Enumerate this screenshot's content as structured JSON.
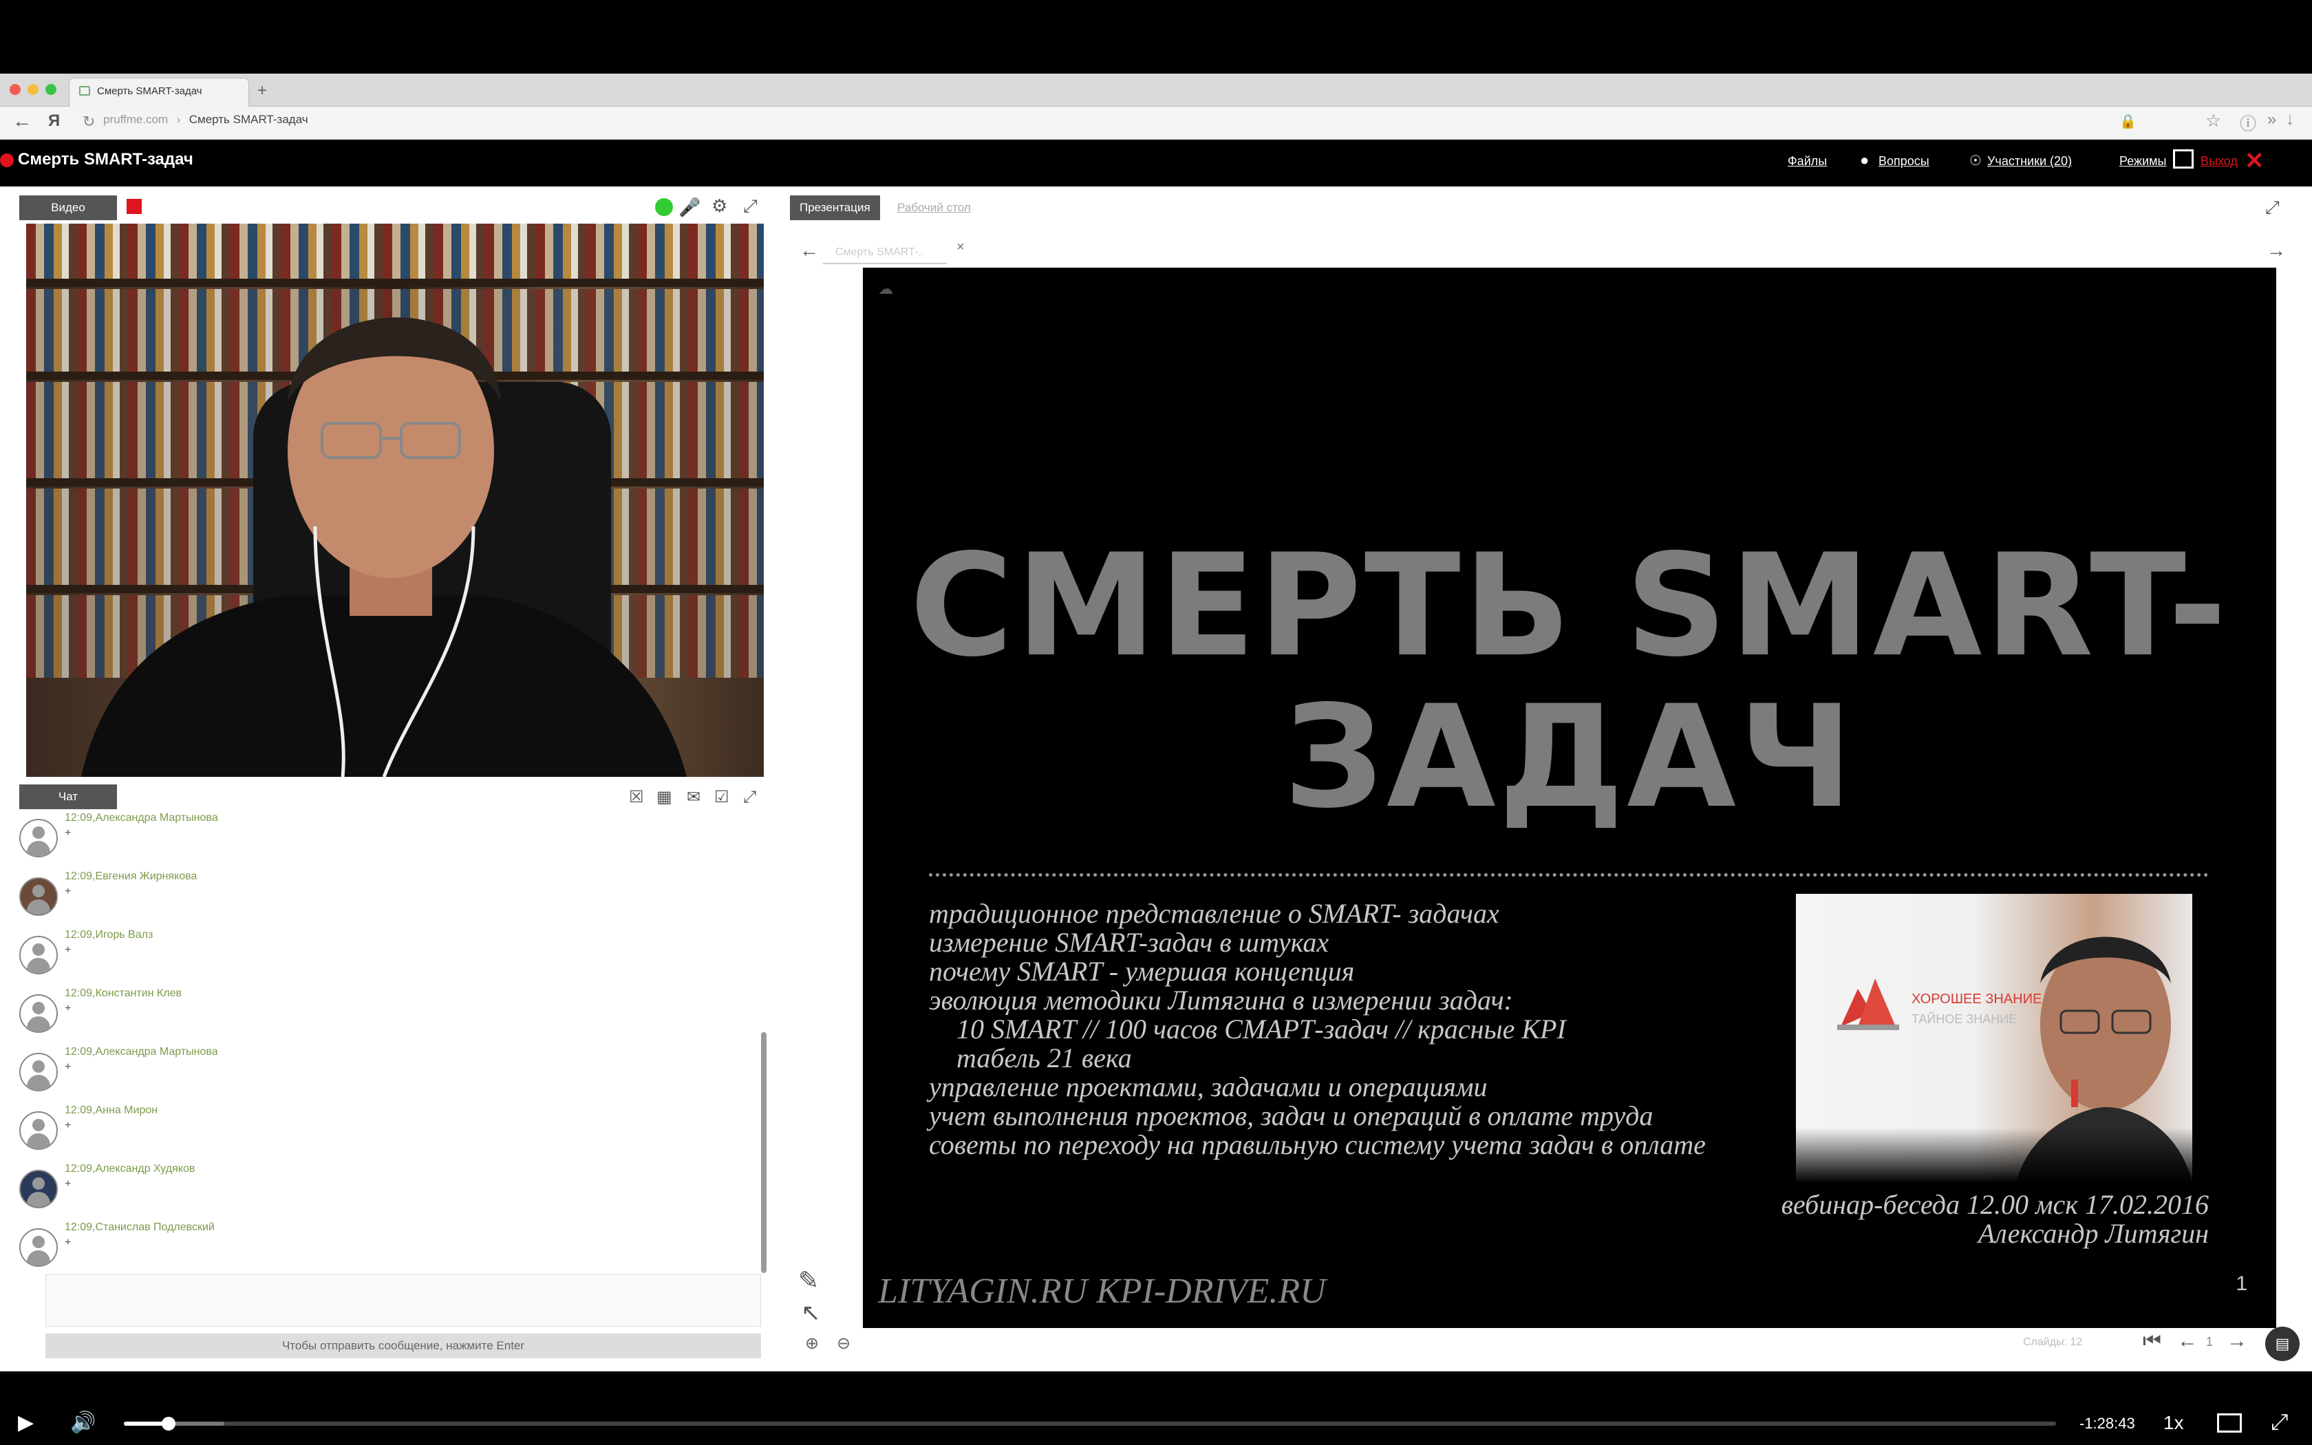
{
  "browser": {
    "tab_title": "Смерть SMART-задач",
    "url_domain": "pruffme.com",
    "url_page": "Смерть SMART-задач"
  },
  "app": {
    "title": "Смерть SMART-задач",
    "nav": {
      "files": "Файлы",
      "questions": "Вопросы",
      "participants": "Участники (20)",
      "modes": "Режимы",
      "exit": "Выход"
    }
  },
  "video_panel": {
    "tab": "Видео"
  },
  "chat": {
    "tab": "Чат",
    "messages": [
      {
        "time_name": "12:09,Александра Мартынова",
        "text": "+"
      },
      {
        "time_name": "12:09,Евгения Жирнякова",
        "text": "+"
      },
      {
        "time_name": "12:09,Игорь Валз",
        "text": "+"
      },
      {
        "time_name": "12:09,Константин Клев",
        "text": "+"
      },
      {
        "time_name": "12:09,Александра Мартынова",
        "text": "+"
      },
      {
        "time_name": "12:09,Анна Мирон",
        "text": "+"
      },
      {
        "time_name": "12:09,Александр Худяков",
        "text": "+"
      },
      {
        "time_name": "12:09,Станислав Подлевский",
        "text": "+"
      }
    ],
    "send_hint": "Чтобы отправить сообщение, нажмите Enter"
  },
  "presentation": {
    "tab_active": "Презентация",
    "tab_other": "Рабочий стол",
    "doc_tab": "Смерть SMART-..",
    "slide": {
      "title_line1": "СМЕРТЬ SMART-",
      "title_line2": "ЗАДАЧ",
      "bullets": [
        "традиционное представление о SMART- задачах",
        "измерение SMART-задач в штуках",
        "почему SMART - умершая концепция",
        "эволюция методики Литягина в измерении задач:",
        "10 SMART // 100 часов СМАРТ-задач // красные KPI",
        "табель 21 века",
        "управление проектами, задачами и операциями",
        "учет выполнения проектов, задач и операций в оплате труда",
        "советы по переходу на правильную систему учета задач в оплате"
      ],
      "photo_caption_1": "ХОРОШЕЕ ЗНАНИЕ",
      "photo_caption_2": "ТАЙНОЕ ЗНАНИЕ",
      "date_line": "вебинар-беседа 12.00 мск 17.02.2016",
      "author": "Александр Литягин",
      "sites": "LITYAGIN.RU  KPI-DRIVE.RU",
      "slide_number": "1"
    },
    "slides_label": "Слайды: 12",
    "page_current": "1"
  },
  "player": {
    "time_remaining": "-1:28:43",
    "speed": "1x",
    "progress": 0.023
  },
  "colors": {
    "accent_red": "#e0141c",
    "chat_name_green": "#7b9b4b",
    "slide_title_gray": "#7c7c7c"
  }
}
